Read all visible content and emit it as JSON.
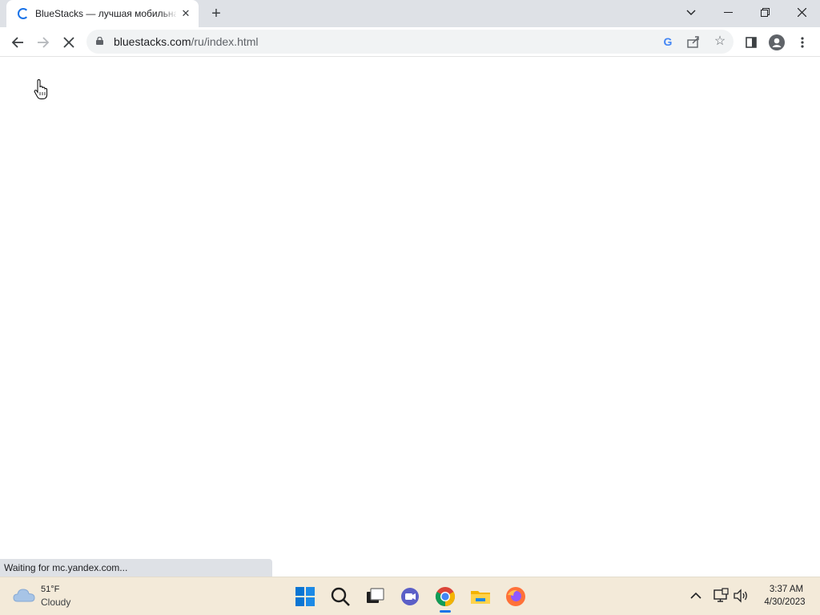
{
  "browser": {
    "tab": {
      "title": "BlueStacks — лучшая мобильная"
    },
    "address_bar": {
      "url_host": "bluestacks.com",
      "url_path": "/ru/index.html"
    },
    "status_text": "Waiting for mc.yandex.com..."
  },
  "taskbar": {
    "weather": {
      "temp": "51°F",
      "condition": "Cloudy"
    },
    "clock": {
      "time": "3:37 AM",
      "date": "4/30/2023"
    }
  },
  "colors": {
    "tabstrip_bg": "#dee1e6",
    "accent_blue": "#1a73e8",
    "taskbar_bg": "#f3ead9"
  }
}
